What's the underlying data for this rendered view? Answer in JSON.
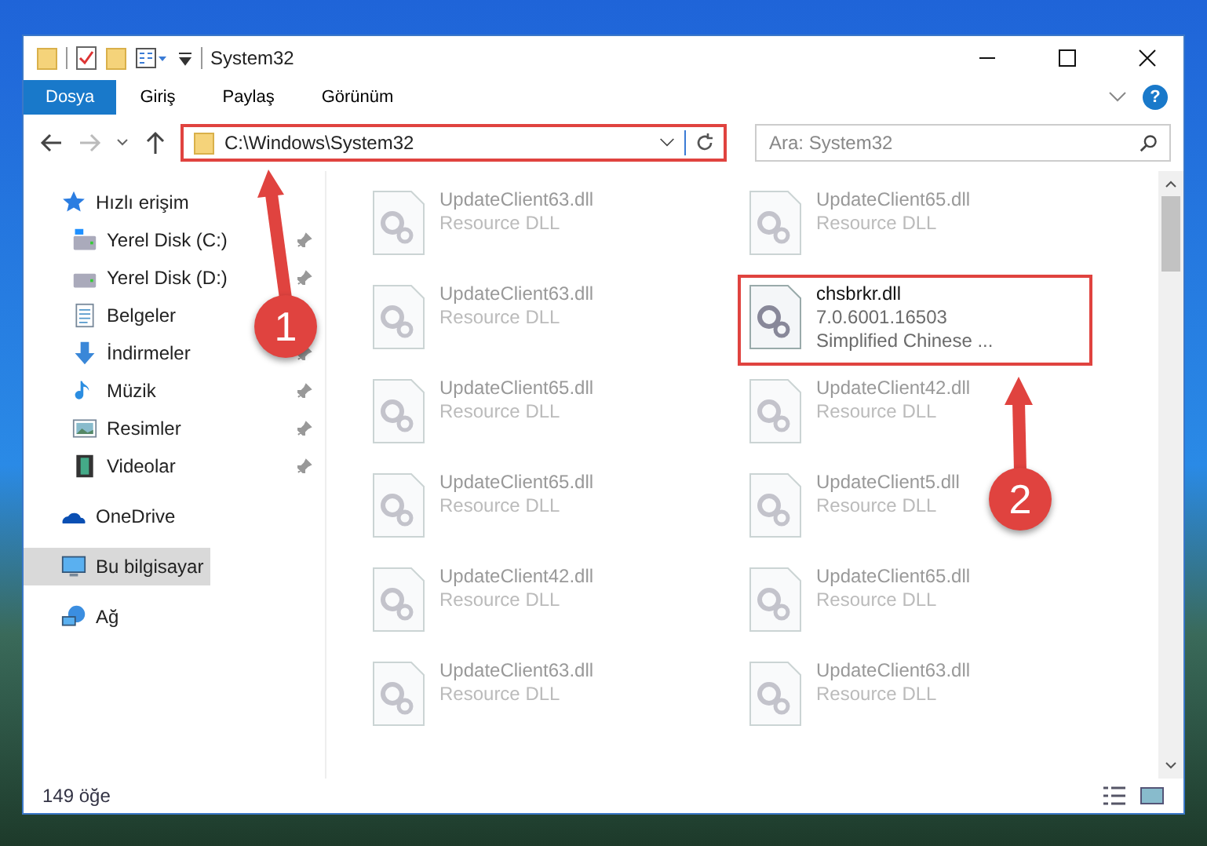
{
  "window": {
    "title": "System32"
  },
  "ribbon": {
    "tabs": [
      {
        "label": "Dosya",
        "kind": "file"
      },
      {
        "label": "Giriş",
        "kind": "tab"
      },
      {
        "label": "Paylaş",
        "kind": "tab"
      },
      {
        "label": "Görünüm",
        "kind": "tab"
      }
    ],
    "help": "?"
  },
  "address": {
    "path": "C:\\Windows\\System32",
    "highlighted": true
  },
  "search": {
    "placeholder": "Ara: System32"
  },
  "sidebar": {
    "items": [
      {
        "label": "Hızlı erişim",
        "kind": "quick",
        "selected": false,
        "children": [
          {
            "label": "Yerel Disk (C:)",
            "kind": "drive-c",
            "pinned": true,
            "selected": false
          },
          {
            "label": "Yerel Disk (D:)",
            "kind": "drive",
            "pinned": true,
            "selected": false
          },
          {
            "label": "Belgeler",
            "kind": "documents",
            "selected": false
          },
          {
            "label": "İndirmeler",
            "kind": "download",
            "pinned": true,
            "selected": false
          },
          {
            "label": "Müzik",
            "kind": "music",
            "pinned": true,
            "selected": false
          },
          {
            "label": "Resimler",
            "kind": "pictures",
            "pinned": true,
            "selected": false
          },
          {
            "label": "Videolar",
            "kind": "videos",
            "pinned": true,
            "selected": false
          }
        ]
      },
      {
        "label": "OneDrive",
        "kind": "cloud",
        "selected": false
      },
      {
        "label": "Bu bilgisayar",
        "kind": "computer",
        "selected": true
      },
      {
        "label": "Ağ",
        "kind": "network",
        "selected": false
      }
    ]
  },
  "files": [
    {
      "lines": [
        "UpdateClient63.dll",
        "Resource DLL"
      ],
      "blurred": true,
      "highlighted": false
    },
    {
      "lines": [
        "UpdateClient65.dll",
        "Resource DLL"
      ],
      "blurred": true,
      "highlighted": false
    },
    {
      "lines": [
        "UpdateClient63.dll",
        "Resource DLL"
      ],
      "blurred": true,
      "highlighted": false
    },
    {
      "lines": [
        "chsbrkr.dll",
        "7.0.6001.16503",
        "Simplified Chinese ..."
      ],
      "blurred": false,
      "highlighted": true
    },
    {
      "lines": [
        "UpdateClient65.dll",
        "Resource DLL"
      ],
      "blurred": true,
      "highlighted": false
    },
    {
      "lines": [
        "UpdateClient42.dll",
        "Resource DLL"
      ],
      "blurred": true,
      "highlighted": false
    },
    {
      "lines": [
        "UpdateClient65.dll",
        "Resource DLL"
      ],
      "blurred": true,
      "highlighted": false
    },
    {
      "lines": [
        "UpdateClient5.dll",
        "Resource DLL"
      ],
      "blurred": true,
      "highlighted": false
    },
    {
      "lines": [
        "UpdateClient42.dll",
        "Resource DLL"
      ],
      "blurred": true,
      "highlighted": false
    },
    {
      "lines": [
        "UpdateClient65.dll",
        "Resource DLL"
      ],
      "blurred": true,
      "highlighted": false
    },
    {
      "lines": [
        "UpdateClient63.dll",
        "Resource DLL"
      ],
      "blurred": true,
      "highlighted": false
    },
    {
      "lines": [
        "UpdateClient63.dll",
        "Resource DLL"
      ],
      "blurred": true,
      "highlighted": false
    }
  ],
  "status_bar": {
    "count": "149 öğe"
  },
  "annotations": [
    {
      "number": "1"
    },
    {
      "number": "2"
    }
  ]
}
